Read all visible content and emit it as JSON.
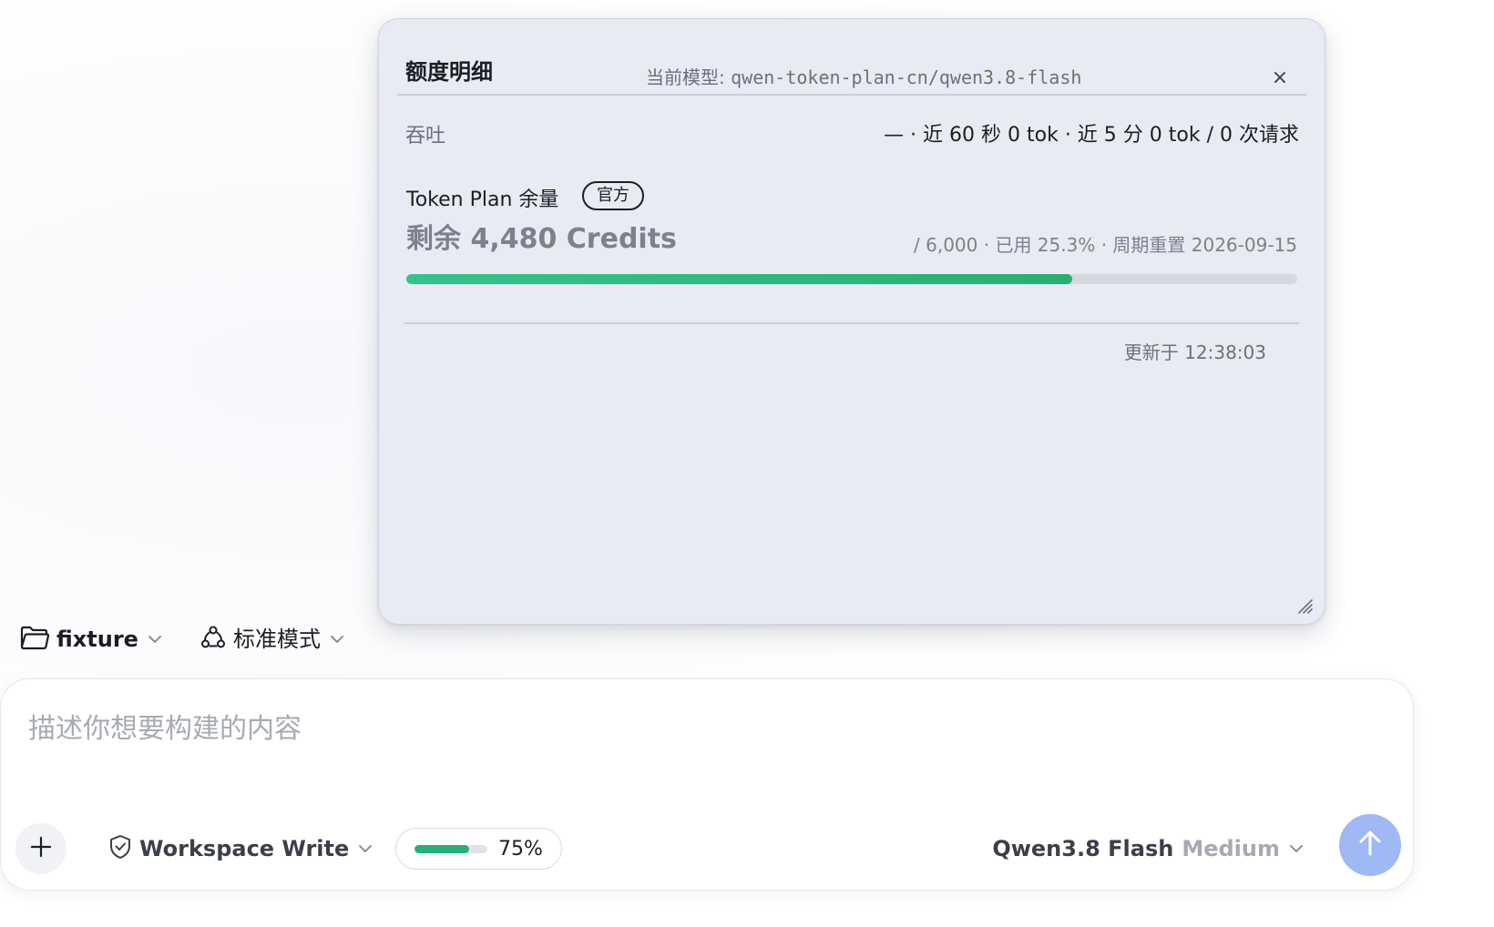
{
  "quota_panel": {
    "title": "额度明细",
    "model_prefix": "当前模型: ",
    "model_id": "qwen-token-plan-cn/qwen3.8-flash",
    "close_symbol": "×",
    "throughput_label": "吞吐",
    "throughput_value": "— · 近 60 秒 0 tok · 近 5 分 0 tok / 0 次请求",
    "plan_title": "Token Plan 余量",
    "plan_badge": "官方",
    "credits_remaining": "剩余 4,480 Credits",
    "credits_meta": "/ 6,000 · 已用 25.3% · 周期重置 2026-09-15",
    "remaining_fraction": 0.747,
    "updated_at": "更新于 12:38:03"
  },
  "context_bar": {
    "folder_label": "fixture",
    "mode_label": "标准模式"
  },
  "composer": {
    "placeholder": "描述你想要构建的内容",
    "value": "",
    "permission_label": "Workspace Write",
    "context_usage_label": "75%",
    "context_usage_fraction": 0.75,
    "model_name": "Qwen3.8 Flash",
    "model_effort": "Medium"
  },
  "colors": {
    "progress_green": "#27b072",
    "send_button": "#9fb8f6",
    "panel_background": "#e8ebf4"
  },
  "icons": {
    "folder": "folder-icon",
    "mode": "tri-circle-icon",
    "chevron": "chevron-down-icon",
    "plus": "plus-icon",
    "shield": "shield-check-icon",
    "send": "arrow-up-icon",
    "close": "close-icon",
    "resize": "resize-grip-icon"
  }
}
